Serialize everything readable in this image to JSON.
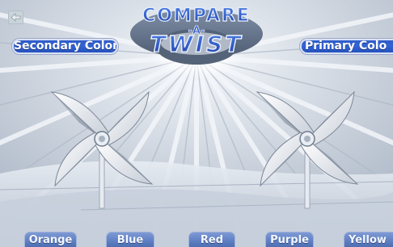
{
  "game": {
    "title_line1": "COMPARE",
    "title_line2": "-A-",
    "title_line3": "TWIST",
    "secondary_label": "Secondary Color",
    "primary_label": "Primary Colo",
    "choices": [
      "Orange",
      "Blue",
      "Red",
      "Purple",
      "Yellow"
    ]
  },
  "icons": {
    "back": "back-arrow-icon",
    "pinwheels": [
      "pinwheel-left",
      "pinwheel-right"
    ]
  },
  "colors": {
    "chip_blue": "#3363d4",
    "title_blue": "#2a55c4",
    "choice_blue": "#6a88c8",
    "background_gray": "#c4ccd8"
  }
}
